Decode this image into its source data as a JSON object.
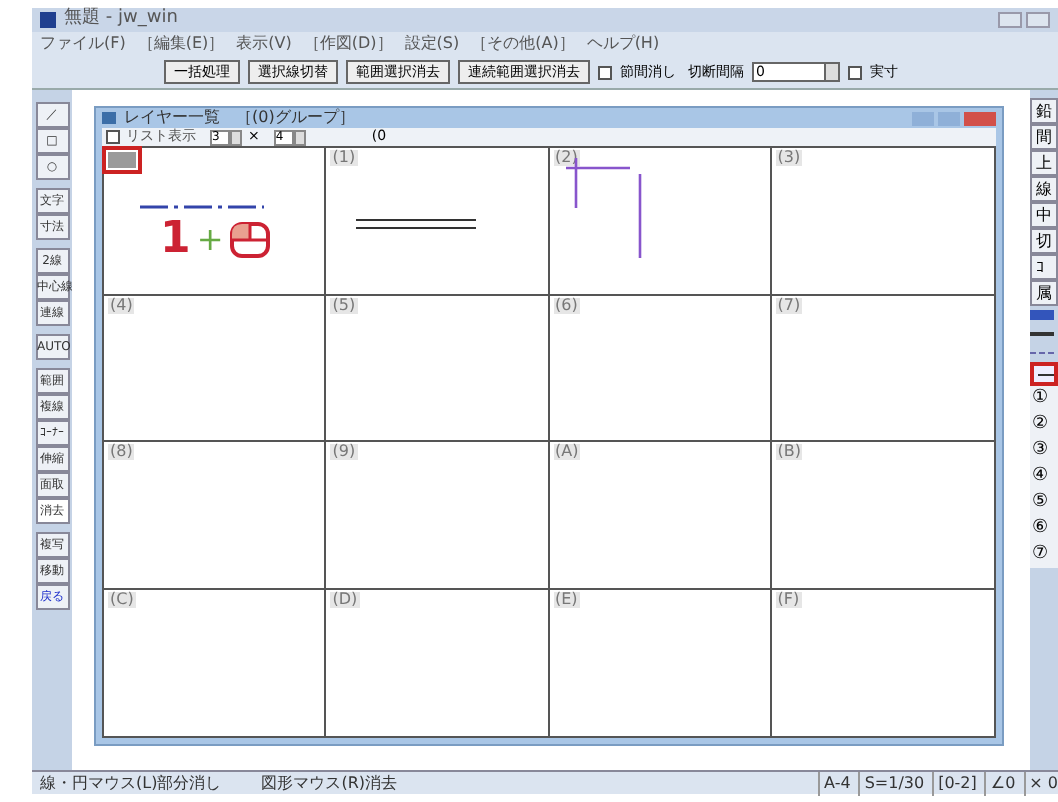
{
  "window": {
    "title": "無題 - jw_win"
  },
  "menu": [
    "ファイル(F)",
    "［編集(E)］",
    "表示(V)",
    "［作図(D)］",
    "設定(S)",
    "［その他(A)］",
    "ヘルプ(H)"
  ],
  "toolbar": {
    "buttons": [
      "一括処理",
      "選択線切替",
      "範囲選択消去",
      "連続範囲選択消去"
    ],
    "node_erase": {
      "label": "節間消し",
      "checked": false
    },
    "gap_label": "切断間隔",
    "gap_value": "0",
    "actual_size": {
      "label": "実寸",
      "checked": false
    }
  },
  "left_tools": [
    {
      "label": "／",
      "selected": false
    },
    {
      "label": "□",
      "selected": false
    },
    {
      "label": "○",
      "selected": false
    },
    {
      "label": "文字",
      "selected": false
    },
    {
      "label": "寸法",
      "selected": false
    },
    {
      "label": "2線",
      "selected": false
    },
    {
      "label": "中心線",
      "selected": false
    },
    {
      "label": "連線",
      "selected": false
    },
    {
      "label": "AUTO",
      "selected": false
    },
    {
      "label": "範囲",
      "selected": false
    },
    {
      "label": "複線",
      "selected": false
    },
    {
      "label": "ｺｰﾅｰ",
      "selected": false
    },
    {
      "label": "伸縮",
      "selected": false
    },
    {
      "label": "面取",
      "selected": false
    },
    {
      "label": "消去",
      "selected": true
    },
    {
      "label": "複写",
      "selected": false
    },
    {
      "label": "移動",
      "selected": false
    },
    {
      "label": "戻る",
      "selected": false
    }
  ],
  "right_tools": [
    "鉛",
    "間",
    "上",
    "線",
    "中",
    "切",
    "ｺ",
    "属"
  ],
  "right_layers": [
    {
      "label": "①",
      "selected": false
    },
    {
      "label": "②",
      "selected": false
    },
    {
      "label": "③",
      "selected": false
    },
    {
      "label": "④",
      "selected": false
    },
    {
      "label": "⑤",
      "selected": false
    },
    {
      "label": "⑥",
      "selected": false
    },
    {
      "label": "⑦",
      "selected": false
    }
  ],
  "layer_window": {
    "title": "レイヤー一覧　［(0)グループ］",
    "list_view": {
      "label": "リスト表示",
      "checked": false
    },
    "cols": "3",
    "rows": "4",
    "times": "×",
    "group_label": "(0",
    "layers": [
      {
        "selected": true,
        "kind": "mouse_hint",
        "digit": "1",
        "plus": "+"
      },
      {
        "label": "(1)",
        "selected": false,
        "kind": "double_line"
      },
      {
        "label": "(2)",
        "selected": false,
        "kind": "corner_lines"
      },
      {
        "label": "(3)",
        "selected": false
      },
      {
        "label": "(4)",
        "selected": false
      },
      {
        "label": "(5)",
        "selected": false
      },
      {
        "label": "(6)",
        "selected": false
      },
      {
        "label": "(7)",
        "selected": false
      },
      {
        "label": "(8)",
        "selected": false
      },
      {
        "label": "(9)",
        "selected": false
      },
      {
        "label": "(A)",
        "selected": false
      },
      {
        "label": "(B)",
        "selected": false
      },
      {
        "label": "(C)",
        "selected": false
      },
      {
        "label": "(D)",
        "selected": false
      },
      {
        "label": "(E)",
        "selected": false
      },
      {
        "label": "(F)",
        "selected": false
      }
    ]
  },
  "status_bar": {
    "left": "線・円マウス(L)部分消し",
    "middle": "図形マウス(R)消去",
    "paper": "A-4",
    "scale": "S=1/30",
    "layer": "[0-2]",
    "angle": "∠0",
    "factor": "× 0"
  }
}
